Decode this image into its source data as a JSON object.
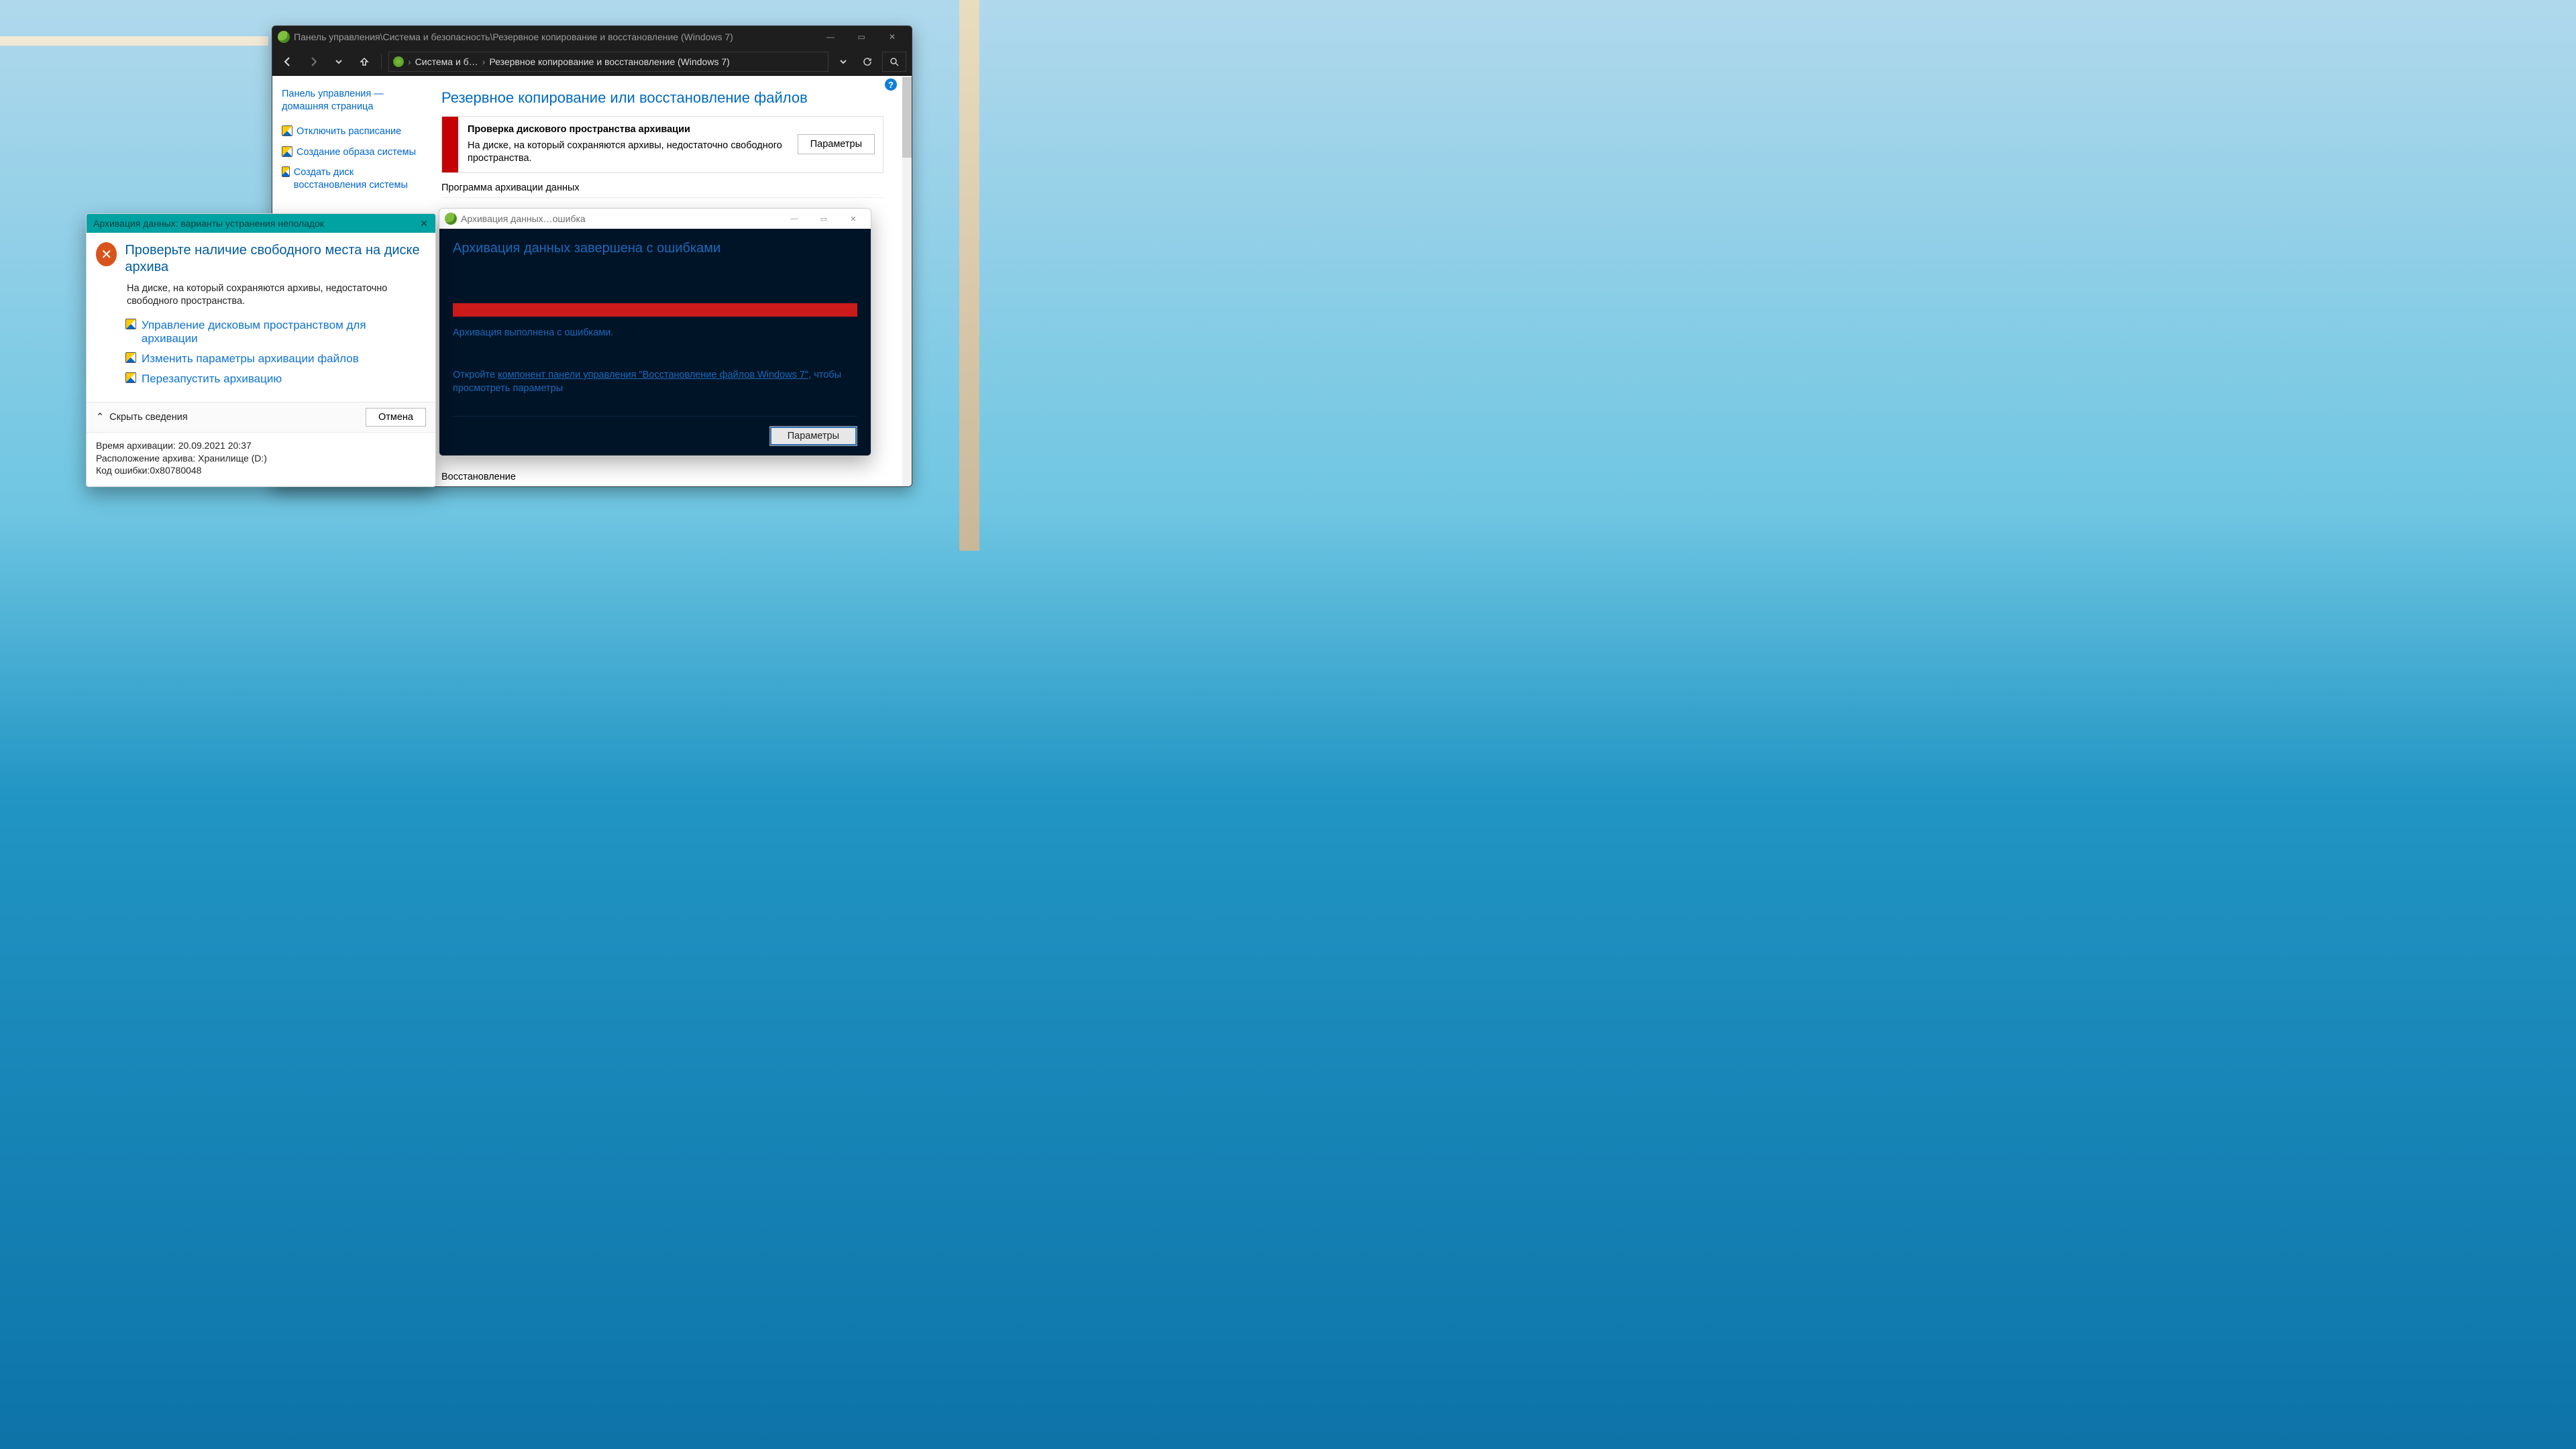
{
  "main_window": {
    "title_path": "Панель управления\\Система и безопасность\\Резервное копирование и восстановление (Windows 7)",
    "breadcrumb": {
      "item1": "Система и б…",
      "item2": "Резервное копирование и восстановление (Windows 7)"
    },
    "side": {
      "home": "Панель управления — домашняя страница",
      "links": [
        "Отключить расписание",
        "Создание образа системы",
        "Создать диск восстановления системы"
      ]
    },
    "content": {
      "heading": "Резервное копирование или восстановление файлов",
      "alert": {
        "title": "Проверка дискового пространства архивации",
        "body": "На диске, на который сохраняются архивы, недостаточно свободного пространства.",
        "button": "Параметры"
      },
      "section1": "Программа архивации данных",
      "restore_head": "Восстановление"
    }
  },
  "err_dialog": {
    "title": "Архивация данных…ошибка",
    "heading": "Архивация данных завершена с ошибками",
    "status": "Архивация выполнена с ошибками.",
    "open_prefix": "Откройте ",
    "open_link": "компонент панели управления \"Восстановление файлов Windows 7\"",
    "open_suffix": ", чтобы просмотреть параметры",
    "button": "Параметры"
  },
  "trbl_dialog": {
    "title": "Архивация данных: варианты устранения неполадок",
    "heading": "Проверьте наличие свободного места на диске архива",
    "body": "На диске, на который сохраняются архивы, недостаточно свободного пространства.",
    "actions": [
      "Управление дисковым пространством для архивации",
      "Изменить параметры архивации файлов",
      "Перезапустить архивацию"
    ],
    "hide_label": "Скрыть сведения",
    "cancel": "Отмена",
    "details": {
      "time_label": "Время архивации: ",
      "time_value": "20.09.2021 20:37",
      "loc_label": "Расположение архива: ",
      "loc_value": "Хранилище (D:)",
      "code_label": "Код ошибки:",
      "code_value": "0x80780048"
    }
  }
}
